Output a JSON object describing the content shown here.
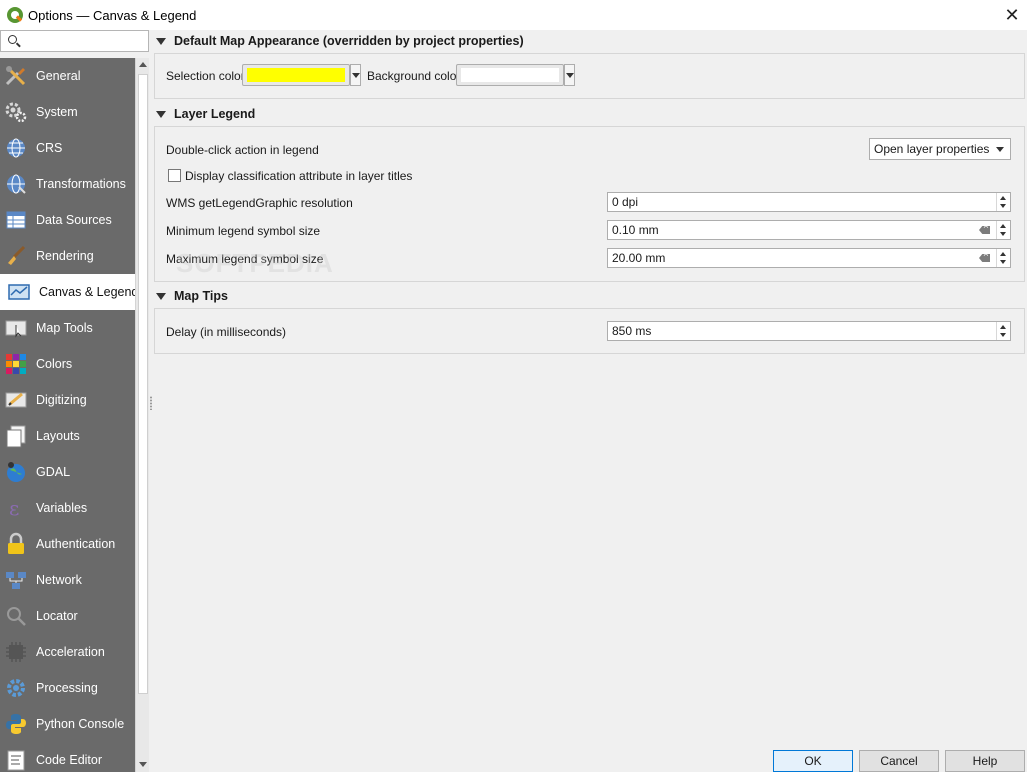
{
  "window": {
    "title": "Options — Canvas & Legend",
    "close_glyph": "✕"
  },
  "search": {
    "placeholder": ""
  },
  "sidebar": {
    "items": [
      {
        "label": "General",
        "icon": "tools-icon"
      },
      {
        "label": "System",
        "icon": "gears-icon"
      },
      {
        "label": "CRS",
        "icon": "globe-icon"
      },
      {
        "label": "Transformations",
        "icon": "globe-transform-icon"
      },
      {
        "label": "Data Sources",
        "icon": "table-icon"
      },
      {
        "label": "Rendering",
        "icon": "paintbrush-icon"
      },
      {
        "label": "Canvas & Legend",
        "icon": "map-canvas-icon",
        "selected": true
      },
      {
        "label": "Map Tools",
        "icon": "map-tools-icon"
      },
      {
        "label": "Colors",
        "icon": "color-grid-icon"
      },
      {
        "label": "Digitizing",
        "icon": "digitizing-icon"
      },
      {
        "label": "Layouts",
        "icon": "layout-pages-icon"
      },
      {
        "label": "GDAL",
        "icon": "gdal-globe-icon"
      },
      {
        "label": "Variables",
        "icon": "epsilon-icon"
      },
      {
        "label": "Authentication",
        "icon": "padlock-icon"
      },
      {
        "label": "Network",
        "icon": "network-icon"
      },
      {
        "label": "Locator",
        "icon": "magnifier-icon"
      },
      {
        "label": "Acceleration",
        "icon": "chip-icon"
      },
      {
        "label": "Processing",
        "icon": "gear-icon"
      },
      {
        "label": "Python Console",
        "icon": "python-icon"
      },
      {
        "label": "Code Editor",
        "icon": "code-editor-icon"
      }
    ]
  },
  "sections": {
    "map_appearance": {
      "title": "Default Map Appearance (overridden by project properties)",
      "selection_color_label": "Selection color",
      "selection_color": "#ffff00",
      "background_color_label": "Background color",
      "background_color": "#ffffff"
    },
    "layer_legend": {
      "title": "Layer Legend",
      "double_click_label": "Double-click action in legend",
      "double_click_value": "Open layer properties",
      "display_class_attr_label": "Display classification attribute in layer titles",
      "display_class_attr_checked": false,
      "wms_resolution_label": "WMS getLegendGraphic resolution",
      "wms_resolution_value": "0 dpi",
      "min_symbol_label": "Minimum legend symbol size",
      "min_symbol_value": "0.10 mm",
      "max_symbol_label": "Maximum legend symbol size",
      "max_symbol_value": "20.00 mm"
    },
    "map_tips": {
      "title": "Map Tips",
      "delay_label": "Delay (in milliseconds)",
      "delay_value": "850 ms"
    }
  },
  "watermark": "SOFTPEDIA",
  "buttons": {
    "ok": "OK",
    "cancel": "Cancel",
    "help": "Help"
  }
}
